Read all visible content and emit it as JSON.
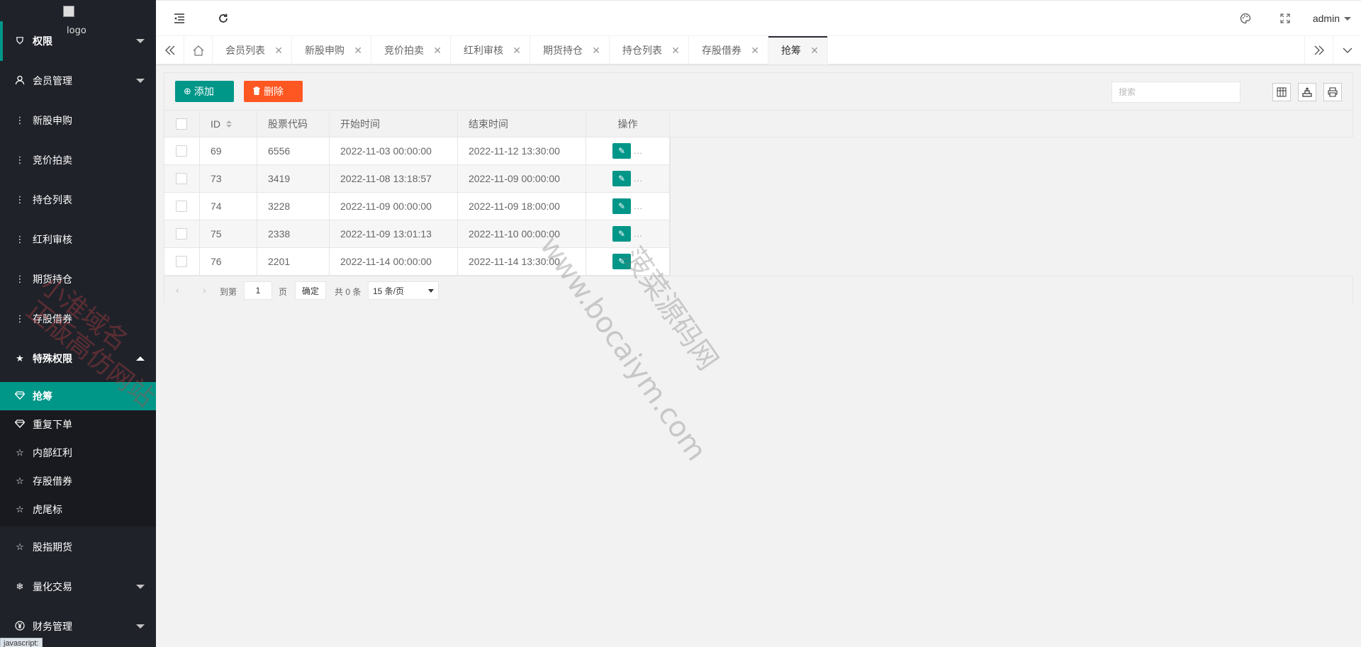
{
  "sidebar": {
    "logo_alt": "logo",
    "items": [
      {
        "label": "权限",
        "icon": "shield-check-icon"
      },
      {
        "label": "会员管理",
        "icon": "user-icon"
      },
      {
        "label": "新股申购",
        "icon": "more-vertical-icon"
      },
      {
        "label": "竞价拍卖",
        "icon": "more-vertical-icon"
      },
      {
        "label": "持仓列表",
        "icon": "more-vertical-icon"
      },
      {
        "label": "红利审核",
        "icon": "more-vertical-icon"
      },
      {
        "label": "期货持仓",
        "icon": "more-vertical-icon"
      },
      {
        "label": "存股借券",
        "icon": "more-vertical-icon"
      },
      {
        "label": "特殊权限",
        "icon": "star-filled-icon"
      }
    ],
    "sub_items": [
      {
        "label": "抢筹",
        "icon": "diamond-icon"
      },
      {
        "label": "重复下单",
        "icon": "diamond-icon"
      },
      {
        "label": "内部红利",
        "icon": "star-outline-icon"
      },
      {
        "label": "存股借券",
        "icon": "star-outline-icon"
      },
      {
        "label": "虎尾标",
        "icon": "star-outline-icon"
      }
    ],
    "bottom_items": [
      {
        "label": "股指期货",
        "icon": "star-outline-icon"
      },
      {
        "label": "量化交易",
        "icon": "snowflake-icon"
      },
      {
        "label": "财务管理",
        "icon": "yen-icon"
      }
    ],
    "status_tip": "javascript:"
  },
  "header": {
    "user": "admin"
  },
  "tabs": [
    {
      "label": "会员列表"
    },
    {
      "label": "新股申购"
    },
    {
      "label": "竞价拍卖"
    },
    {
      "label": "红利审核"
    },
    {
      "label": "期货持仓"
    },
    {
      "label": "持仓列表"
    },
    {
      "label": "存股借券"
    },
    {
      "label": "抢筹",
      "active": true
    }
  ],
  "toolbar": {
    "add_label": "添加",
    "delete_label": "删除",
    "search_placeholder": "搜索"
  },
  "table": {
    "columns": [
      "ID",
      "股票代码",
      "开始时间",
      "结束时间",
      "操作"
    ],
    "rows": [
      {
        "id": "69",
        "code": "6556",
        "start": "2022-11-03 00:00:00",
        "end": "2022-11-12 13:30:00"
      },
      {
        "id": "73",
        "code": "3419",
        "start": "2022-11-08 13:18:57",
        "end": "2022-11-09 00:00:00"
      },
      {
        "id": "74",
        "code": "3228",
        "start": "2022-11-09 00:00:00",
        "end": "2022-11-09 18:00:00"
      },
      {
        "id": "75",
        "code": "2338",
        "start": "2022-11-09 13:01:13",
        "end": "2022-11-10 00:00:00"
      },
      {
        "id": "76",
        "code": "2201",
        "start": "2022-11-14 00:00:00",
        "end": "2022-11-14 13:30:00"
      }
    ],
    "more": "..."
  },
  "pager": {
    "goto_label": "到第",
    "page_value": "1",
    "page_unit": "页",
    "confirm_label": "确定",
    "total_label": "共 0 条",
    "page_size": "15 条/页"
  },
  "watermarks": {
    "site_url": "www.bocaiym.com",
    "site_name": "菠菜源码网",
    "red_line1": "小淮域名",
    "red_line2": "正版高仿网站"
  },
  "colors": {
    "accent": "#009688",
    "danger": "#ff5722",
    "sidebar_bg": "#20222a"
  }
}
